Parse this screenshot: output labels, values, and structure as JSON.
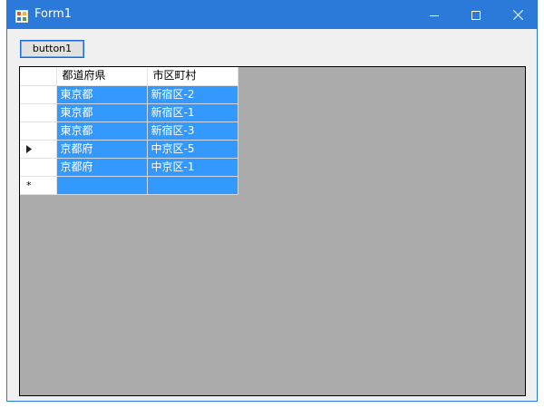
{
  "window": {
    "title": "Form1"
  },
  "toolbar": {
    "button1_label": "button1"
  },
  "grid": {
    "columns": [
      "都道府県",
      "市区町村"
    ],
    "rows": [
      {
        "marker": "",
        "values": [
          "東京都",
          "新宿区-2"
        ]
      },
      {
        "marker": "",
        "values": [
          "東京都",
          "新宿区-1"
        ]
      },
      {
        "marker": "",
        "values": [
          "東京都",
          "新宿区-3"
        ]
      },
      {
        "marker": "current-row-arrow",
        "values": [
          "京都府",
          "中京区-5"
        ]
      },
      {
        "marker": "",
        "values": [
          "京都府",
          "中京区-1"
        ]
      },
      {
        "marker": "*",
        "values": [
          "",
          ""
        ]
      }
    ]
  },
  "colors": {
    "titlebar": "#2b79d9",
    "selection": "#3399ff",
    "grid_background": "#ababab",
    "form_background": "#f0f0f0"
  }
}
